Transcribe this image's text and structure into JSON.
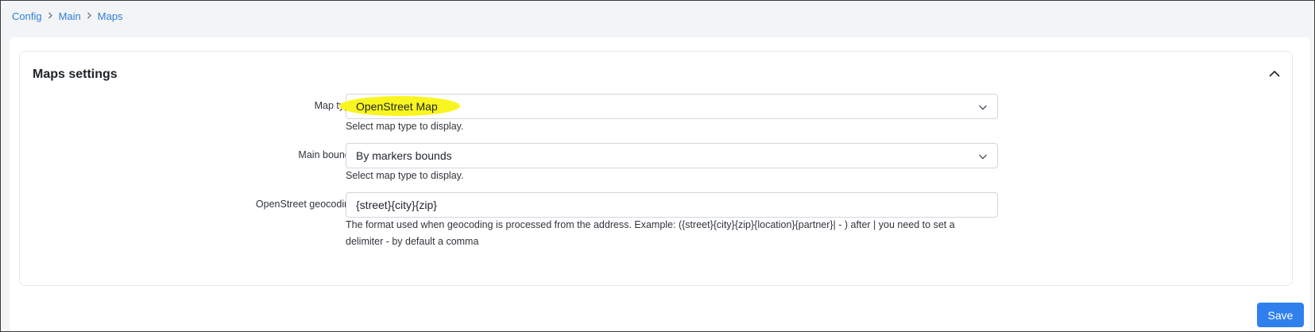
{
  "breadcrumb": [
    "Config",
    "Main",
    "Maps"
  ],
  "card": {
    "title": "Maps settings"
  },
  "fields": {
    "map_type": {
      "label": "Map type",
      "value": "OpenStreet Map",
      "help": "Select map type to display."
    },
    "main_bounds": {
      "label": "Main bounds",
      "value": "By markers bounds",
      "help": "Select map type to display."
    },
    "geocoding": {
      "label": "OpenStreet geocoding",
      "value": "{street}{city}{zip}",
      "help": "The format used when geocoding is processed from the address. Example: ({street}{city}{zip}{location}{partner}| - ) after | you need to set a delimiter - by default a comma"
    }
  },
  "actions": {
    "save_label": "Save"
  },
  "colors": {
    "link": "#2c7fd6",
    "primary_button": "#2f80ed",
    "highlight": "#f8f520"
  },
  "icons": [
    "chevron-right-icon",
    "chevron-up-icon",
    "chevron-down-icon"
  ]
}
